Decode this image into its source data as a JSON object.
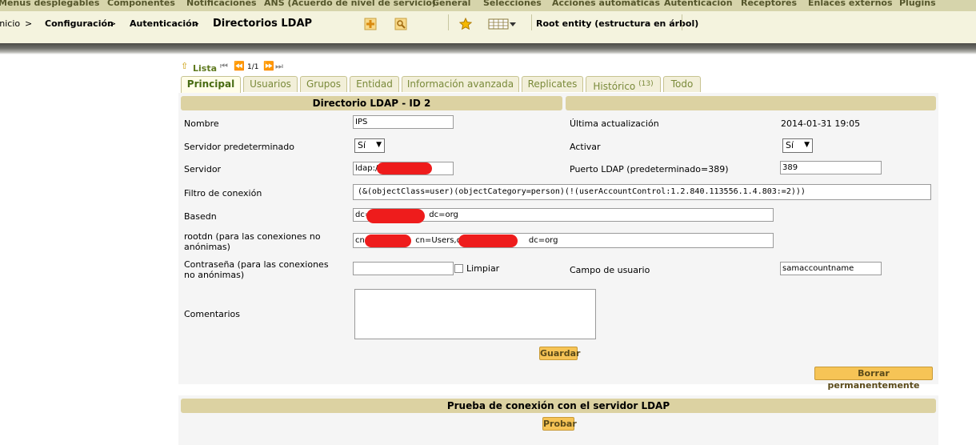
{
  "menu": [
    "Menus desplegables",
    "Componentes",
    "Notificaciones",
    "ANS (Acuerdo de nivel de servicio)",
    "General",
    "Selecciones",
    "Acciones automáticas",
    "Autenticación",
    "Receptores",
    "Enlaces externos",
    "Plugins"
  ],
  "breadcrumb": {
    "inicio": "Inicio",
    "configuracion": "Configuración",
    "autenticacion": "Autenticación",
    "title": "Directorios LDAP",
    "sep": ">"
  },
  "entity": "Root entity (estructura en árbol)",
  "listnav": {
    "lista": "Lista",
    "pages": "1/1"
  },
  "tabs": [
    {
      "label": "Principal"
    },
    {
      "label": "Usuarios"
    },
    {
      "label": "Grupos"
    },
    {
      "label": "Entidad"
    },
    {
      "label": "Información avanzada"
    },
    {
      "label": "Replicates"
    },
    {
      "label": "Histórico",
      "badge": "(13)"
    },
    {
      "label": "Todo"
    }
  ],
  "form": {
    "header": "Directorio LDAP - ID 2",
    "nombre": {
      "label": "Nombre",
      "value": "IPS"
    },
    "ultima": {
      "label": "Última actualización",
      "value": "2014-01-31 19:05"
    },
    "servpred": {
      "label": "Servidor predeterminado",
      "value": "Sí"
    },
    "activar": {
      "label": "Activar",
      "value": "Sí"
    },
    "servidor": {
      "label": "Servidor",
      "value": "ldap://"
    },
    "puerto": {
      "label": "Puerto LDAP (predeterminado=389)",
      "value": "389"
    },
    "filtro": {
      "label": "Filtro de conexión",
      "value": "(&(objectClass=user)(objectCategory=person)(!(userAccountControl:1.2.840.113556.1.4.803:=2)))"
    },
    "basedn": {
      "label": "Basedn",
      "prefix": "dc=",
      "suffix": "dc=org"
    },
    "rootdn": {
      "label": "rootdn (para las conexiones no anónimas)",
      "p1": "cn=",
      "p2": "cn=Users,dc=",
      "p3": "dc=org"
    },
    "password": {
      "label": "Contraseña (para las conexiones no anónimas)",
      "limpiar": "Limpiar"
    },
    "campo": {
      "label": "Campo de usuario",
      "value": "samaccountname"
    },
    "comentarios": {
      "label": "Comentarios"
    },
    "guardar": "Guardar",
    "borrar": "Borrar permanentemente"
  },
  "test": {
    "header": "Prueba de conexión con el servidor LDAP",
    "probar": "Probar"
  },
  "colors": {
    "accent": "#f6c456",
    "header": "#dcd2a2",
    "menubar": "#d6d4ab",
    "redaction": "#ee1c1c"
  }
}
